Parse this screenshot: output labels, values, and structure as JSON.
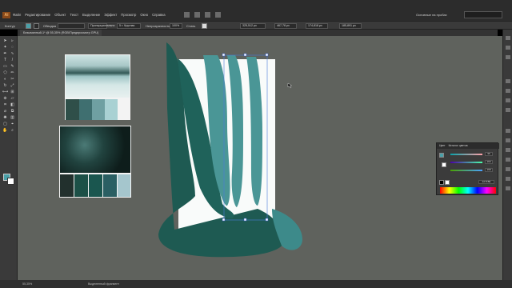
{
  "menubar": {
    "logo": "Ai",
    "items": [
      "Файл",
      "Редактирование",
      "Объект",
      "Текст",
      "Выделение",
      "Эффект",
      "Просмотр",
      "Окно",
      "Справка"
    ],
    "workspace": "Основные на пробах",
    "icons": [
      "bridge-icon",
      "stock-icon",
      "arrange-documents-icon",
      "gpu-icon"
    ]
  },
  "controlbar": {
    "selection_label": "Контур",
    "stroke_label": "Обводка",
    "profile_label": "Пропорционально",
    "brush_value": "5 т. Круглая",
    "opacity_label": "Непрозрачность",
    "opacity_value": "100%",
    "style_label": "Стиль",
    "x_value": "325,512 px",
    "y_value": "467,78 px",
    "w_value": "174,818 px",
    "h_value": "185,891 px",
    "colors": {
      "fill": "#4aa0a8",
      "stroke": "#2a2a2a"
    }
  },
  "document_tab": {
    "title": "Безымянный-1* @ 55,35% (RGB/Предпросмотр GPU)"
  },
  "toolbar": {
    "tools": [
      "selection-tool",
      "direct-selection-tool",
      "magic-wand-tool",
      "lasso-tool",
      "pen-tool",
      "curvature-tool",
      "type-tool",
      "line-tool",
      "rectangle-tool",
      "paintbrush-tool",
      "shaper-tool",
      "pencil-tool",
      "eraser-tool",
      "scissors-tool",
      "rotate-tool",
      "scale-tool",
      "width-tool",
      "free-transform-tool",
      "shape-builder-tool",
      "perspective-tool",
      "mesh-tool",
      "gradient-tool",
      "eyedropper-tool",
      "blend-tool",
      "symbol-sprayer-tool",
      "column-graph-tool",
      "artboard-tool",
      "slice-tool",
      "hand-tool",
      "zoom-tool"
    ],
    "fill_color": "#4aa0a8",
    "stroke_color": "#ffffff"
  },
  "palette_cards": [
    {
      "name": "mountain-lake-palette",
      "swatches": [
        "#2f4f49",
        "#3f6f70",
        "#6fa0a2",
        "#a9d1d3"
      ]
    },
    {
      "name": "leaves-palette",
      "swatches": [
        "#22302d",
        "#1c5047",
        "#1a564f",
        "#2a5f63",
        "#a5c6cd"
      ]
    }
  ],
  "artwork": {
    "dark_teal": "#1e5a52",
    "light_teal": "#3d8a8a"
  },
  "properties_panel": {
    "tabs": [
      "Цвет",
      "Каталог цветов"
    ],
    "r_value": "96",
    "g_value": "160",
    "b_value": "168",
    "hex_value": "2A7F8E"
  },
  "status": {
    "zoom": "55,35%",
    "tool": "Выделенный фрагмент"
  }
}
